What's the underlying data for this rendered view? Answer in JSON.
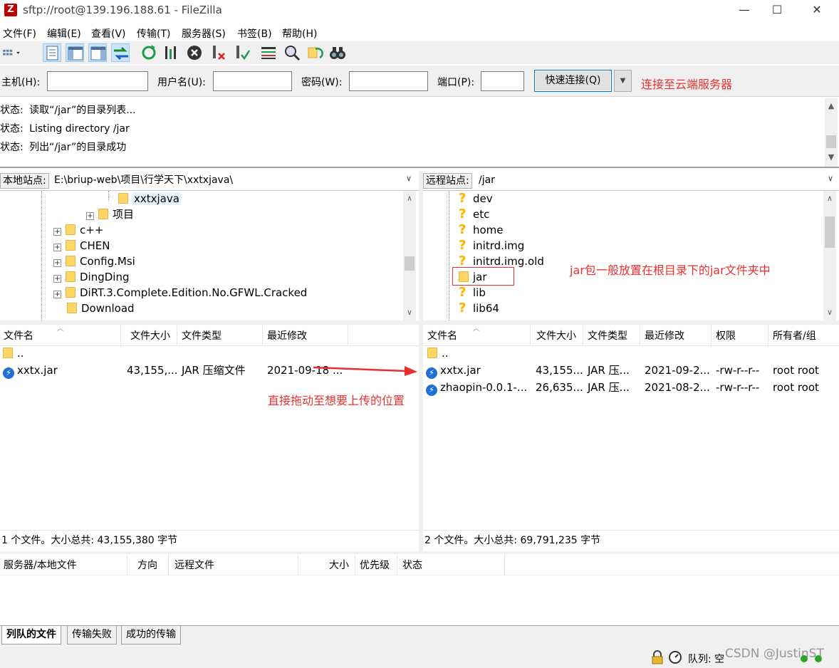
{
  "window": {
    "title": "sftp://root@139.196.188.61 - FileZilla",
    "app_icon_glyph": "Z",
    "controls": {
      "minimize": "—",
      "maximize": "☐",
      "close": "✕"
    }
  },
  "menu": [
    "文件(F)",
    "编辑(E)",
    "查看(V)",
    "传输(T)",
    "服务器(S)",
    "书签(B)",
    "帮助(H)"
  ],
  "quickconnect": {
    "host_label": "主机(H):",
    "user_label": "用户名(U):",
    "pass_label": "密码(W):",
    "port_label": "端口(P):",
    "host_value": "",
    "user_value": "",
    "pass_value": "",
    "port_value": "",
    "connect_button": "快速连接(Q)",
    "dropdown_glyph": "▼",
    "annotation": "连接至云端服务器"
  },
  "log": [
    {
      "prefix": "状态:",
      "text": "读取“/jar”的目录列表..."
    },
    {
      "prefix": "状态:",
      "text": "Listing directory /jar"
    },
    {
      "prefix": "状态:",
      "text": "列出“/jar”的目录成功"
    }
  ],
  "local": {
    "site_label": "本地站点:",
    "path": "E:\\briup-web\\项目\\行学天下\\xxtxjava\\",
    "tree": [
      {
        "label": "xxtxjava",
        "selected": true
      },
      {
        "label": "项目",
        "expander": "+"
      },
      {
        "label": "c++",
        "expander": "+"
      },
      {
        "label": "CHEN",
        "expander": "+"
      },
      {
        "label": "Config.Msi",
        "expander": "+"
      },
      {
        "label": "DingDing",
        "expander": "+"
      },
      {
        "label": "DiRT.3.Complete.Edition.No.GFWL.Cracked",
        "expander": "+"
      },
      {
        "label": "Download",
        "expander": ""
      }
    ],
    "columns": [
      "文件名",
      "文件大小",
      "文件类型",
      "最近修改"
    ],
    "files": [
      {
        "name": "..",
        "size": "",
        "type": "",
        "modified": ""
      },
      {
        "name": "xxtx.jar",
        "size": "43,155,...",
        "type": "JAR 压缩文件",
        "modified": "2021-09-18 ..."
      }
    ],
    "summary": "1 个文件。大小总共: 43,155,380 字节",
    "annotation": "直接拖动至想要上传的位置"
  },
  "remote": {
    "site_label": "远程站点:",
    "path": "/jar",
    "tree": [
      {
        "label": "dev",
        "icon": "?"
      },
      {
        "label": "etc",
        "icon": "?"
      },
      {
        "label": "home",
        "icon": "?"
      },
      {
        "label": "initrd.img",
        "icon": "?"
      },
      {
        "label": "initrd.img.old",
        "icon": "?"
      },
      {
        "label": "jar",
        "icon": "folder"
      },
      {
        "label": "lib",
        "icon": "?"
      },
      {
        "label": "lib64",
        "icon": "?"
      }
    ],
    "annotation": "jar包一般放置在根目录下的jar文件夹中",
    "columns": [
      "文件名",
      "文件大小",
      "文件类型",
      "最近修改",
      "权限",
      "所有者/组"
    ],
    "files": [
      {
        "name": "..",
        "size": "",
        "type": "",
        "modified": "",
        "perm": "",
        "owner": ""
      },
      {
        "name": "xxtx.jar",
        "size": "43,155...",
        "type": "JAR 压...",
        "modified": "2021-09-2...",
        "perm": "-rw-r--r--",
        "owner": "root root"
      },
      {
        "name": "zhaopin-0.0.1-...",
        "size": "26,635...",
        "type": "JAR 压...",
        "modified": "2021-08-2...",
        "perm": "-rw-r--r--",
        "owner": "root root"
      }
    ],
    "summary": "2 个文件。大小总共: 69,791,235 字节"
  },
  "queue": {
    "columns": [
      "服务器/本地文件",
      "方向",
      "远程文件",
      "大小",
      "优先级",
      "状态"
    ],
    "tabs": [
      "列队的文件",
      "传输失败",
      "成功的传输"
    ],
    "status": "队列: 空",
    "watermark": "CSDN @JustinST"
  },
  "colors": {
    "annotation": "#e8312f",
    "accent": "#0078d7"
  }
}
